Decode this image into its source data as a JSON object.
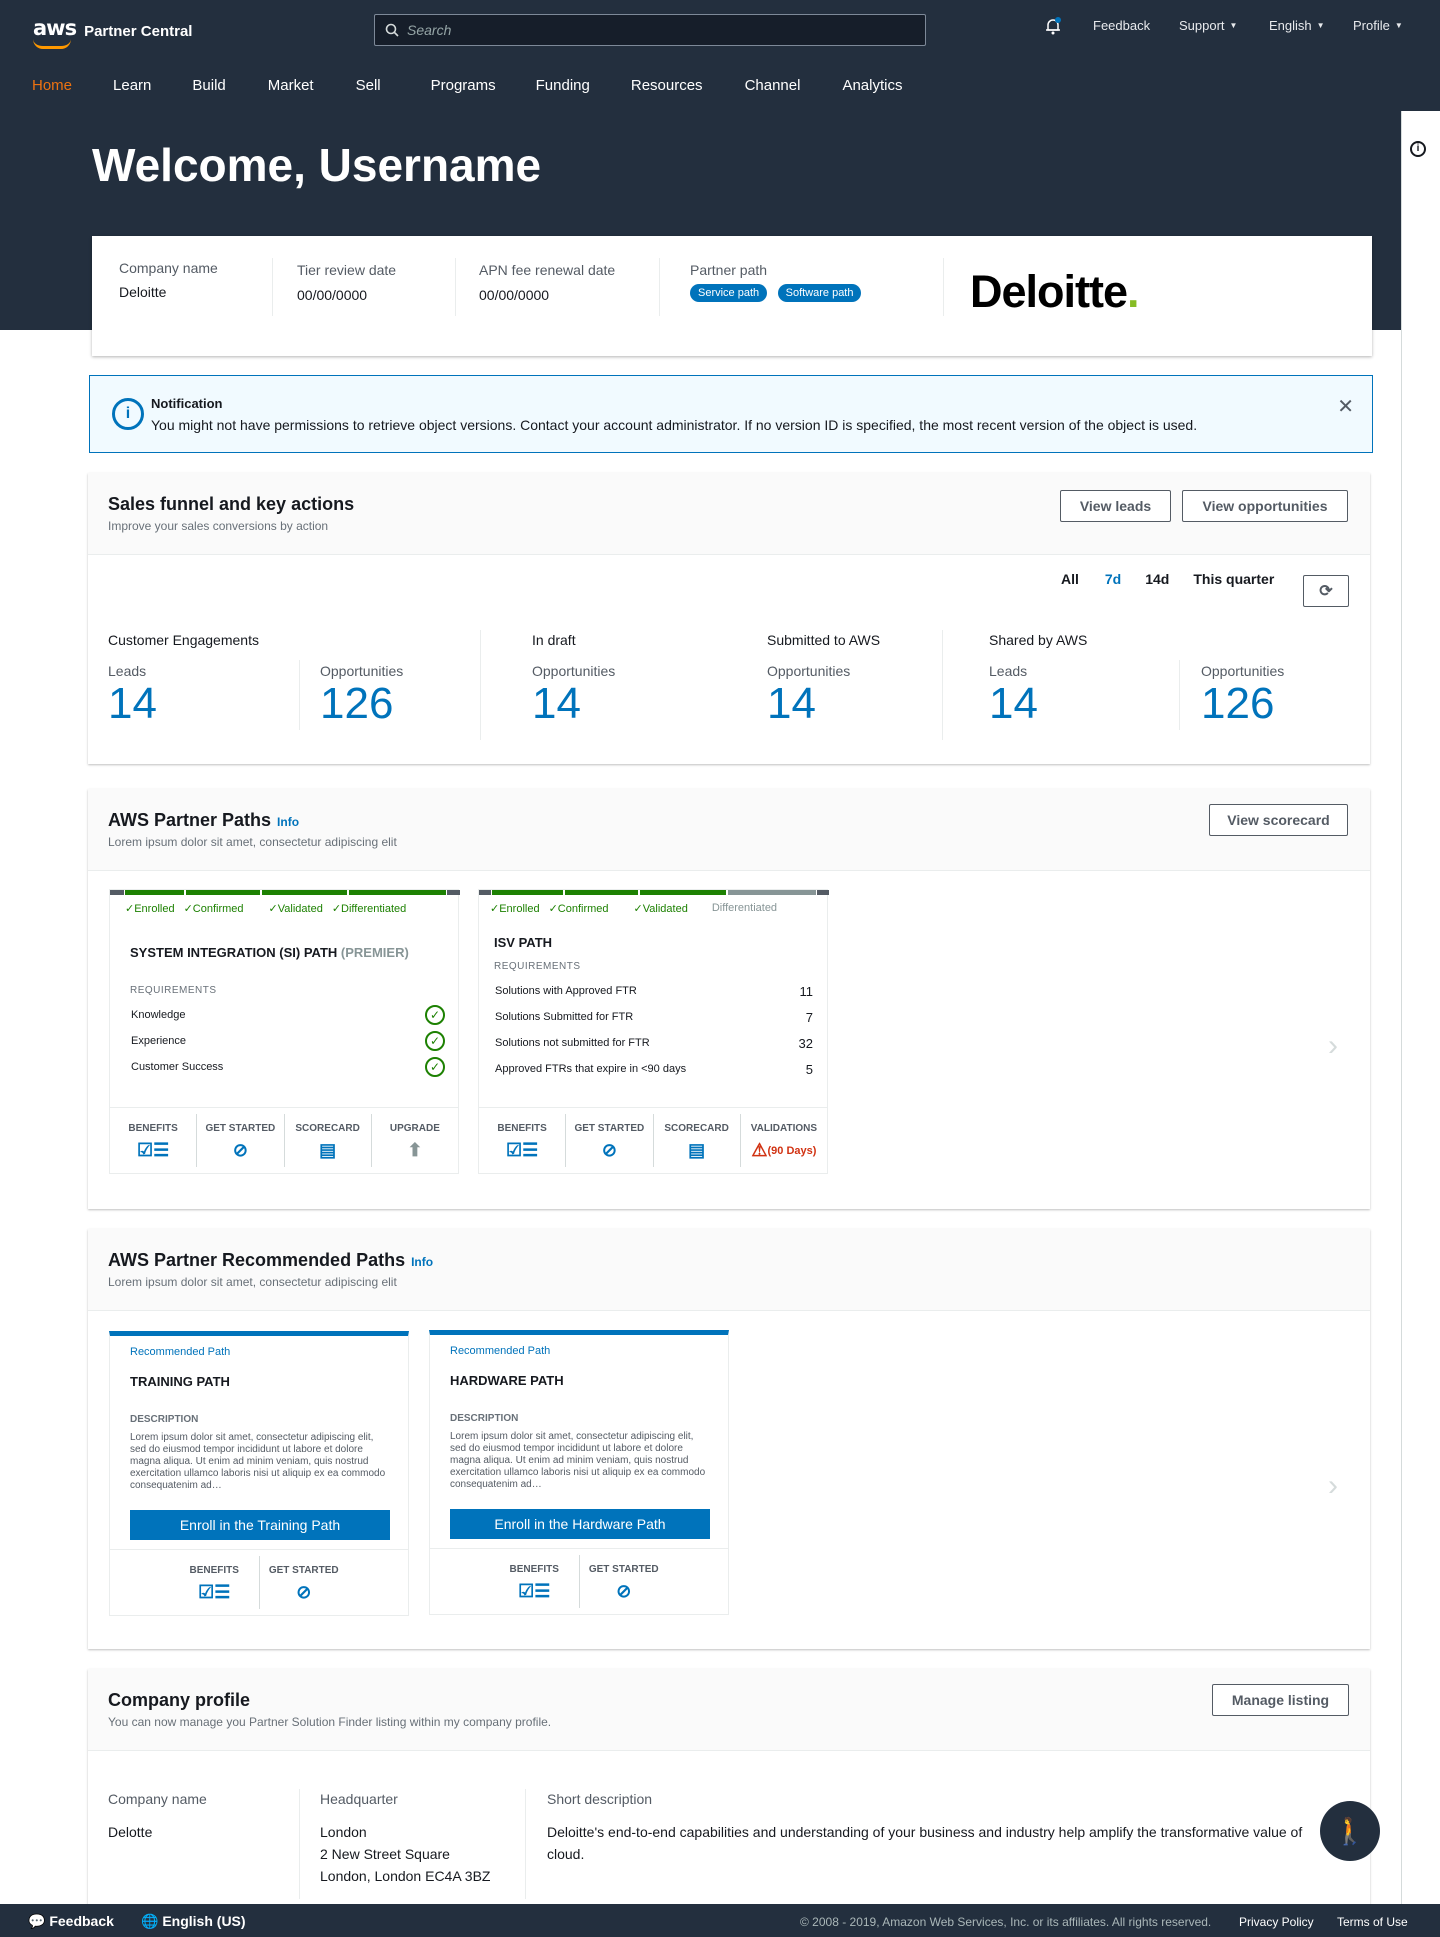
{
  "header": {
    "brand": "aws",
    "product": "Partner Central",
    "search_placeholder": "Search",
    "feedback": "Feedback",
    "support": "Support",
    "language": "English",
    "profile": "Profile"
  },
  "nav": [
    "Home",
    "Learn",
    "Build",
    "Market",
    "Sell",
    "Programs",
    "Funding",
    "Resources",
    "Channel",
    "Analytics"
  ],
  "welcome": "Welcome, Username",
  "company": {
    "name_label": "Company name",
    "name": "Deloitte",
    "tier_label": "Tier review date",
    "tier": "00/00/0000",
    "apn_label": "APN fee renewal date",
    "apn": "00/00/0000",
    "path_label": "Partner path",
    "paths": [
      "Service path",
      "Software path"
    ],
    "logo_text": "Deloitte",
    "logo_dot": "."
  },
  "notification": {
    "title": "Notification",
    "message": "You might not have permissions to retrieve object versions. Contact your account administrator. If no version ID is specified, the most recent version of the object is used."
  },
  "sales": {
    "title": "Sales funnel and key actions",
    "subtitle": "Improve your sales conversions by action",
    "btn_leads": "View leads",
    "btn_opps": "View opportunities",
    "filters": [
      "All",
      "7d",
      "14d",
      "This quarter"
    ],
    "groups": {
      "ce": "Customer Engagements",
      "draft": "In draft",
      "submitted": "Submitted to AWS",
      "shared": "Shared by AWS"
    },
    "metrics": [
      {
        "label": "Leads",
        "value": "14"
      },
      {
        "label": "Opportunities",
        "value": "126"
      },
      {
        "label": "Opportunities",
        "value": "14"
      },
      {
        "label": "Opportunities",
        "value": "14"
      },
      {
        "label": "Leads",
        "value": "14"
      },
      {
        "label": "Opportunities",
        "value": "126"
      }
    ]
  },
  "paths": {
    "title": "AWS Partner Paths",
    "info": "Info",
    "subtitle": "Lorem ipsum dolor sit amet, consectetur adipiscing elit",
    "btn": "View scorecard",
    "si": {
      "steps": [
        "✓Enrolled",
        "✓Confirmed",
        "✓Validated",
        "✓Differentiated"
      ],
      "title": "SYSTEM INTEGRATION (SI) PATH",
      "tier": "(PREMIER)",
      "req": "REQUIREMENTS",
      "rows": [
        "Knowledge",
        "Experience",
        "Customer Success"
      ],
      "foot": [
        "BENEFITS",
        "GET STARTED",
        "SCORECARD",
        "UPGRADE"
      ]
    },
    "isv": {
      "steps": [
        "✓Enrolled",
        "✓Confirmed",
        "✓Validated",
        "Differentiated"
      ],
      "title": "ISV PATH",
      "req": "REQUIREMENTS",
      "rows": [
        {
          "k": "Solutions with Approved FTR",
          "v": "11"
        },
        {
          "k": "Solutions Submitted for FTR",
          "v": "7"
        },
        {
          "k": "Solutions not submitted for FTR",
          "v": "32"
        },
        {
          "k": "Approved FTRs that expire in <90 days",
          "v": "5"
        }
      ],
      "foot": [
        "BENEFITS",
        "GET STARTED",
        "SCORECARD",
        "VALIDATIONS"
      ],
      "warn": "(90 Days)"
    }
  },
  "recommended": {
    "title": "AWS Partner Recommended Paths",
    "info": "Info",
    "subtitle": "Lorem ipsum dolor sit amet, consectetur adipiscing elit",
    "cards": [
      {
        "tag": "Recommended Path",
        "title": "TRAINING PATH",
        "desc_label": "DESCRIPTION",
        "desc": "Lorem ipsum dolor sit amet, consectetur adipiscing elit, sed do eiusmod tempor incididunt ut labore et dolore magna aliqua. Ut enim ad minim veniam, quis nostrud exercitation ullamco laboris nisi ut aliquip ex ea commodo consequatenim ad…",
        "btn": "Enroll in the Training Path",
        "foot": [
          "BENEFITS",
          "GET STARTED"
        ]
      },
      {
        "tag": "Recommended Path",
        "title": "HARDWARE PATH",
        "desc_label": "DESCRIPTION",
        "desc": "Lorem ipsum dolor sit amet, consectetur adipiscing elit, sed do eiusmod tempor incididunt ut labore et dolore magna aliqua. Ut enim ad minim veniam, quis nostrud exercitation ullamco laboris nisi ut aliquip ex ea commodo consequatenim ad…",
        "btn": "Enroll in the Hardware Path",
        "foot": [
          "BENEFITS",
          "GET STARTED"
        ]
      }
    ]
  },
  "profile": {
    "title": "Company profile",
    "subtitle": "You can now manage you Partner Solution Finder listing within my company profile.",
    "btn": "Manage listing",
    "name_label": "Company name",
    "name": "Delotte",
    "hq_label": "Headquarter",
    "hq": [
      "London",
      "2 New Street Square",
      "London, London EC4A 3BZ"
    ],
    "desc_label": "Short description",
    "desc": "Deloitte's end-to-end capabilities and understanding of your business and industry help amplify the transformative value of cloud."
  },
  "footer": {
    "feedback": "Feedback",
    "language": "English (US)",
    "copyright": "© 2008 - 2019, Amazon Web Services, Inc. or its affiliates. All rights reserved.",
    "privacy": "Privacy Policy",
    "terms": "Terms of Use"
  },
  "colors": {
    "navy": "#232f3e",
    "orange": "#ec7211",
    "blue": "#0073bb",
    "green": "#1d8102"
  }
}
